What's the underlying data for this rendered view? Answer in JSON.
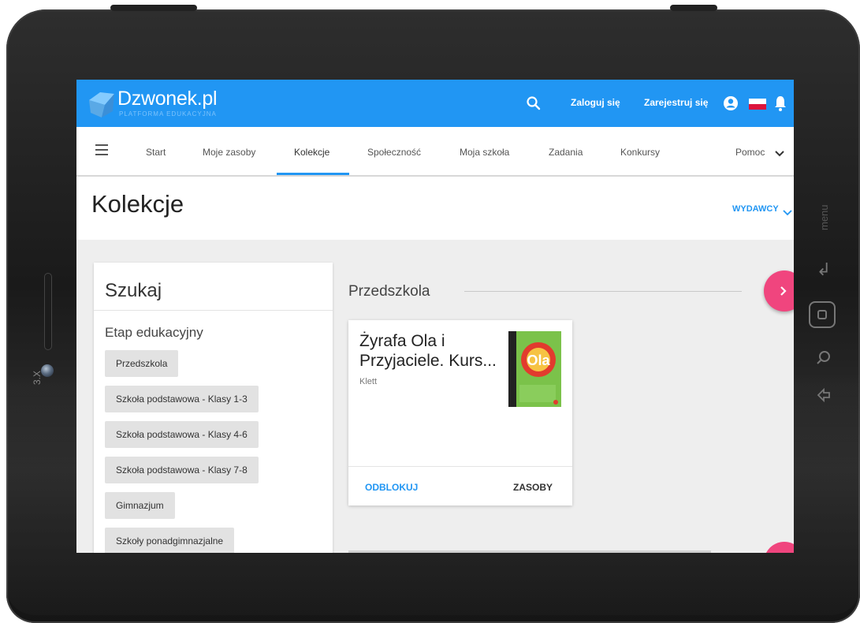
{
  "device": {
    "zoom_label": "3.X",
    "side_menu_label": "menu"
  },
  "topbar": {
    "brand": "Dzwonek.pl",
    "brand_sub": "PLATFORMA EDUKACYJNA",
    "login_label": "Zaloguj się",
    "register_label": "Zarejestruj się",
    "icons": [
      "search-icon",
      "account-icon",
      "flag-pl-icon",
      "bell-icon"
    ],
    "color": "#2196f3"
  },
  "nav": {
    "items": [
      "Start",
      "Moje zasoby",
      "Kolekcje",
      "Społeczność",
      "Moja szkoła",
      "Zadania",
      "Konkursy"
    ],
    "active": "Kolekcje",
    "help_label": "Pomoc"
  },
  "page": {
    "title": "Kolekcje",
    "publishers_label": "WYDAWCY"
  },
  "search": {
    "title": "Szukaj",
    "stage_label": "Etap edukacyjny",
    "stages": [
      "Przedszkola",
      "Szkoła podstawowa - Klasy 1-3",
      "Szkoła podstawowa - Klasy 4-6",
      "Szkoła podstawowa - Klasy 7-8",
      "Gimnazjum",
      "Szkoły ponadgimnazjalne"
    ]
  },
  "section": {
    "title": "Przedszkola",
    "card": {
      "title": "Żyrafa Ola i Przyjaciele. Kurs...",
      "publisher": "Klett",
      "cover_text": "Ola",
      "unlock_label": "ODBLOKUJ",
      "resources_label": "ZASOBY"
    }
  },
  "colors": {
    "accent": "#2196f3",
    "fab": "#f0457e"
  }
}
